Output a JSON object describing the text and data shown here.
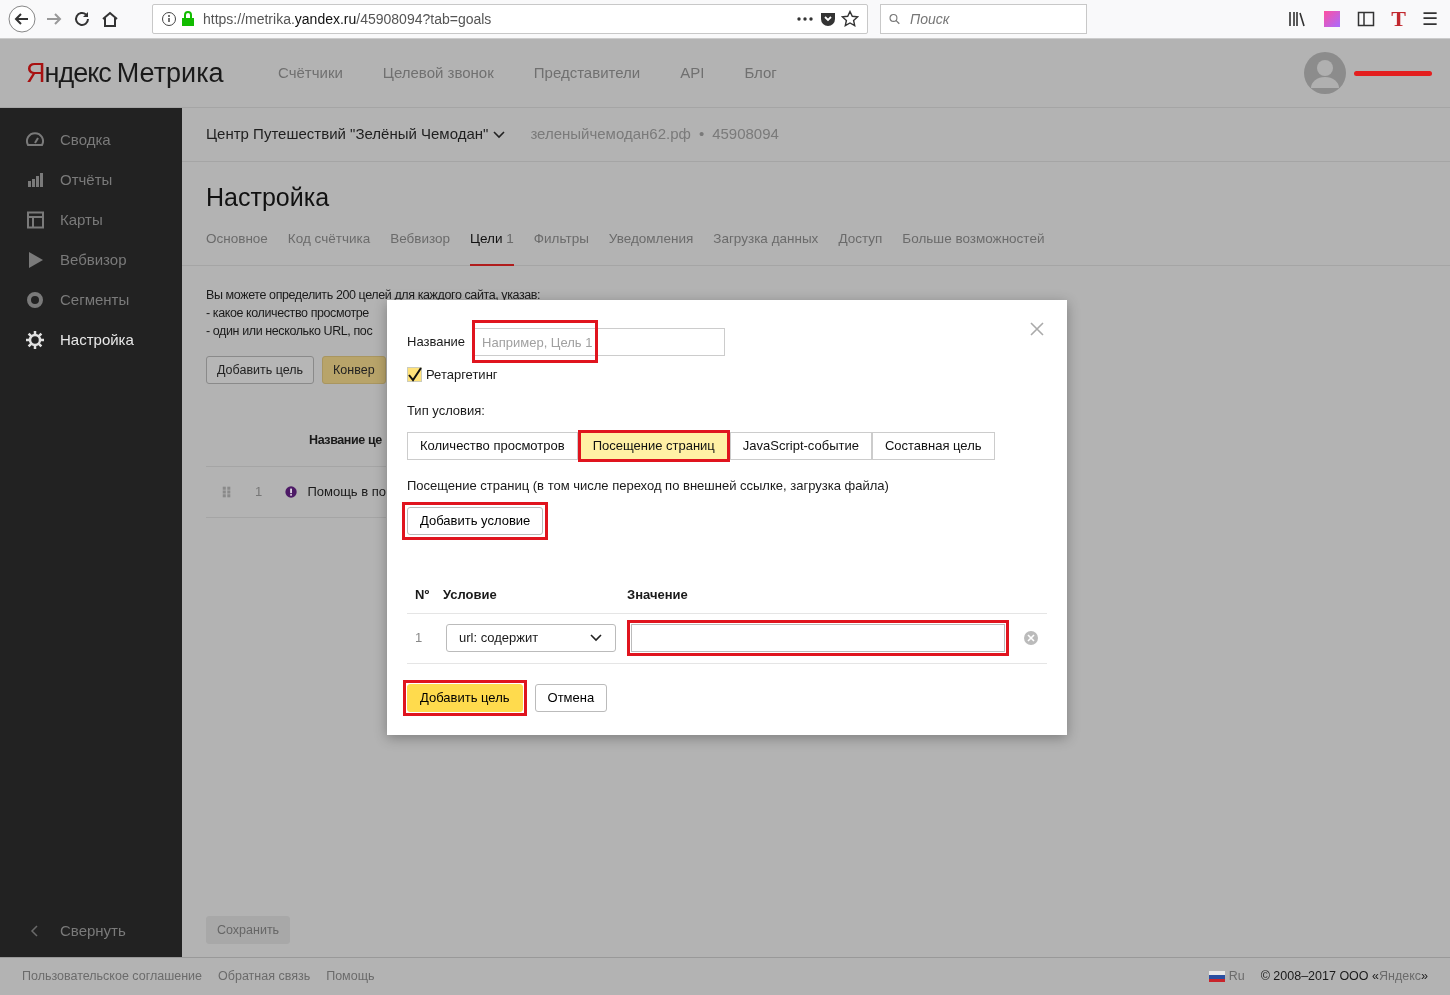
{
  "browser": {
    "url_prefix": "https://metrika.",
    "url_host": "yandex.ru",
    "url_path": "/45908094?tab=goals",
    "search_placeholder": "Поиск",
    "menu_glyph": "☰",
    "extension_letter": "T"
  },
  "header": {
    "logo_brand": "Яндекс",
    "logo_product": "Метрика",
    "nav": [
      "Счётчики",
      "Целевой звонок",
      "Представители",
      "API",
      "Блог"
    ]
  },
  "sidebar": {
    "items": [
      {
        "label": "Сводка",
        "selected": false
      },
      {
        "label": "Отчёты",
        "selected": false
      },
      {
        "label": "Карты",
        "selected": false
      },
      {
        "label": "Вебвизор",
        "selected": false
      },
      {
        "label": "Сегменты",
        "selected": false
      },
      {
        "label": "Настройка",
        "selected": true
      }
    ],
    "collapse": "Свернуть"
  },
  "counter": {
    "name": "Центр Путешествий \"Зелёный Чемодан\"",
    "domain": "зеленыйчемодан62.рф",
    "separator": "•",
    "id": "45908094"
  },
  "page_title": "Настройка",
  "tabs": [
    {
      "label": "Основное",
      "selected": false
    },
    {
      "label": "Код счётчика",
      "selected": false
    },
    {
      "label": "Вебвизор",
      "selected": false
    },
    {
      "label": "Цели",
      "count": "1",
      "selected": true
    },
    {
      "label": "Фильтры",
      "selected": false
    },
    {
      "label": "Уведомления",
      "selected": false
    },
    {
      "label": "Загрузка данных",
      "selected": false
    },
    {
      "label": "Доступ",
      "selected": false
    },
    {
      "label": "Больше возможностей",
      "selected": false
    }
  ],
  "intro": [
    "Вы можете определить 200 целей для каждого сайта, указав:",
    "-  какое количество просмотре",
    "-  один или несколько URL, пос"
  ],
  "goal_buttons": [
    {
      "label": "Добавить цель",
      "kind": "plain"
    },
    {
      "label": "Конвер",
      "kind": "accent"
    }
  ],
  "goals_table": {
    "column_header": "Название це",
    "rows": [
      {
        "number": "1",
        "name": "Помощь в по"
      }
    ]
  },
  "dialog": {
    "name_label": "Название",
    "name_placeholder": "Например, Цель 1",
    "retargeting": {
      "label": "Ретаргетинг",
      "checked": true
    },
    "condition_type_label": "Тип условия:",
    "condition_types": [
      {
        "label": "Количество просмотров",
        "selected": false
      },
      {
        "label": "Посещение страниц",
        "selected": true
      },
      {
        "label": "JavaScript-событие",
        "selected": false
      },
      {
        "label": "Составная цель",
        "selected": false
      }
    ],
    "description": "Посещение страниц (в том числе переход по внешней ссылке, загрузка файла)",
    "add_condition": "Добавить условие",
    "columns": [
      "Nº",
      "Условие",
      "Значение"
    ],
    "conditions": [
      {
        "number": "1",
        "condition": "url: содержит"
      }
    ],
    "submit": "Добавить цель",
    "cancel": "Отмена"
  },
  "save_button": "Сохранить",
  "footer": {
    "links": [
      "Пользовательское соглашение",
      "Обратная связь",
      "Помощь"
    ],
    "language": "Ru",
    "copyright_prefix": "© 2008–2017 ООО «",
    "copyright_link": "Яндекс",
    "copyright_suffix": "»"
  }
}
